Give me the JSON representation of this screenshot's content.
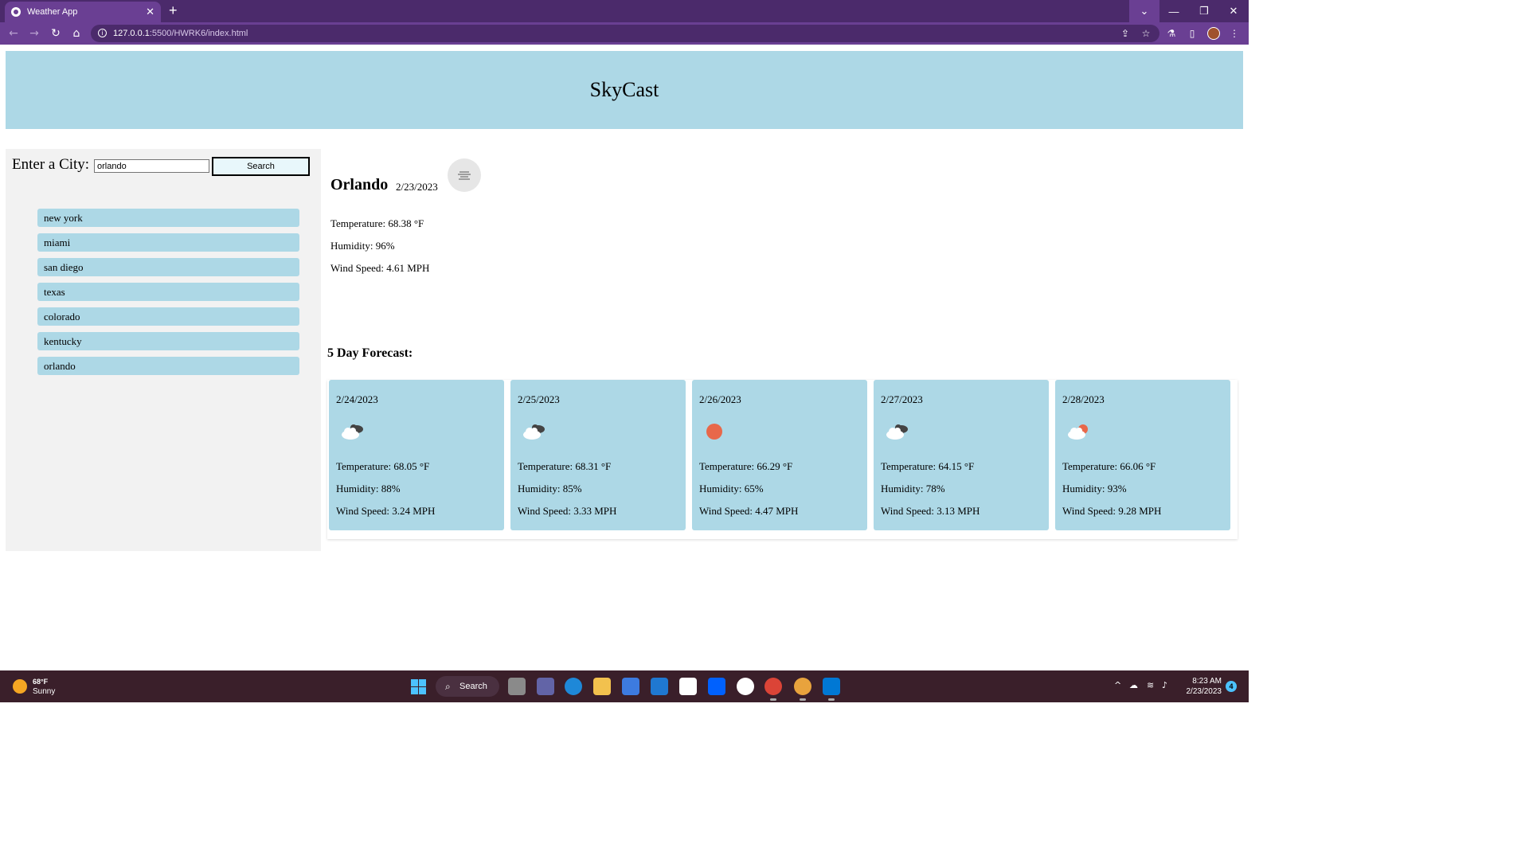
{
  "browser": {
    "tab_title": "Weather App",
    "tab_close": "✕",
    "new_tab": "+",
    "url_host": "127.0.0.1",
    "url_path": ":5500/HWRK6/index.html",
    "theme_color": "#6a3f93"
  },
  "app": {
    "title": "SkyCast",
    "header_color": "#add8e6"
  },
  "search": {
    "label": "Enter a City:",
    "value": "orlando",
    "button_label": "Search"
  },
  "history": [
    "new york",
    "miami",
    "san diego",
    "texas",
    "colorado",
    "kentucky",
    "orlando"
  ],
  "current": {
    "city": "Orlando",
    "date": "2/23/2023",
    "icon": "mist-icon",
    "temperature": "Temperature: 68.38 °F",
    "humidity": "Humidity: 96%",
    "wind": "Wind Speed: 4.61 MPH"
  },
  "forecast": {
    "title": "5 Day Forecast:",
    "days": [
      {
        "date": "2/24/2023",
        "icon": "broken-clouds-icon",
        "temperature": "Temperature: 68.05 °F",
        "humidity": "Humidity: 88%",
        "wind": "Wind Speed: 3.24 MPH"
      },
      {
        "date": "2/25/2023",
        "icon": "broken-clouds-icon",
        "temperature": "Temperature: 68.31 °F",
        "humidity": "Humidity: 85%",
        "wind": "Wind Speed: 3.33 MPH"
      },
      {
        "date": "2/26/2023",
        "icon": "clear-sky-icon",
        "temperature": "Temperature: 66.29 °F",
        "humidity": "Humidity: 65%",
        "wind": "Wind Speed: 4.47 MPH"
      },
      {
        "date": "2/27/2023",
        "icon": "broken-clouds-icon",
        "temperature": "Temperature: 64.15 °F",
        "humidity": "Humidity: 78%",
        "wind": "Wind Speed: 3.13 MPH"
      },
      {
        "date": "2/28/2023",
        "icon": "few-clouds-icon",
        "temperature": "Temperature: 66.06 °F",
        "humidity": "Humidity: 93%",
        "wind": "Wind Speed: 9.28 MPH"
      }
    ]
  },
  "taskbar": {
    "weather_temp": "68°F",
    "weather_cond": "Sunny",
    "search_label": "Search",
    "time": "8:23 AM",
    "date": "2/23/2023",
    "notifications": "4"
  }
}
